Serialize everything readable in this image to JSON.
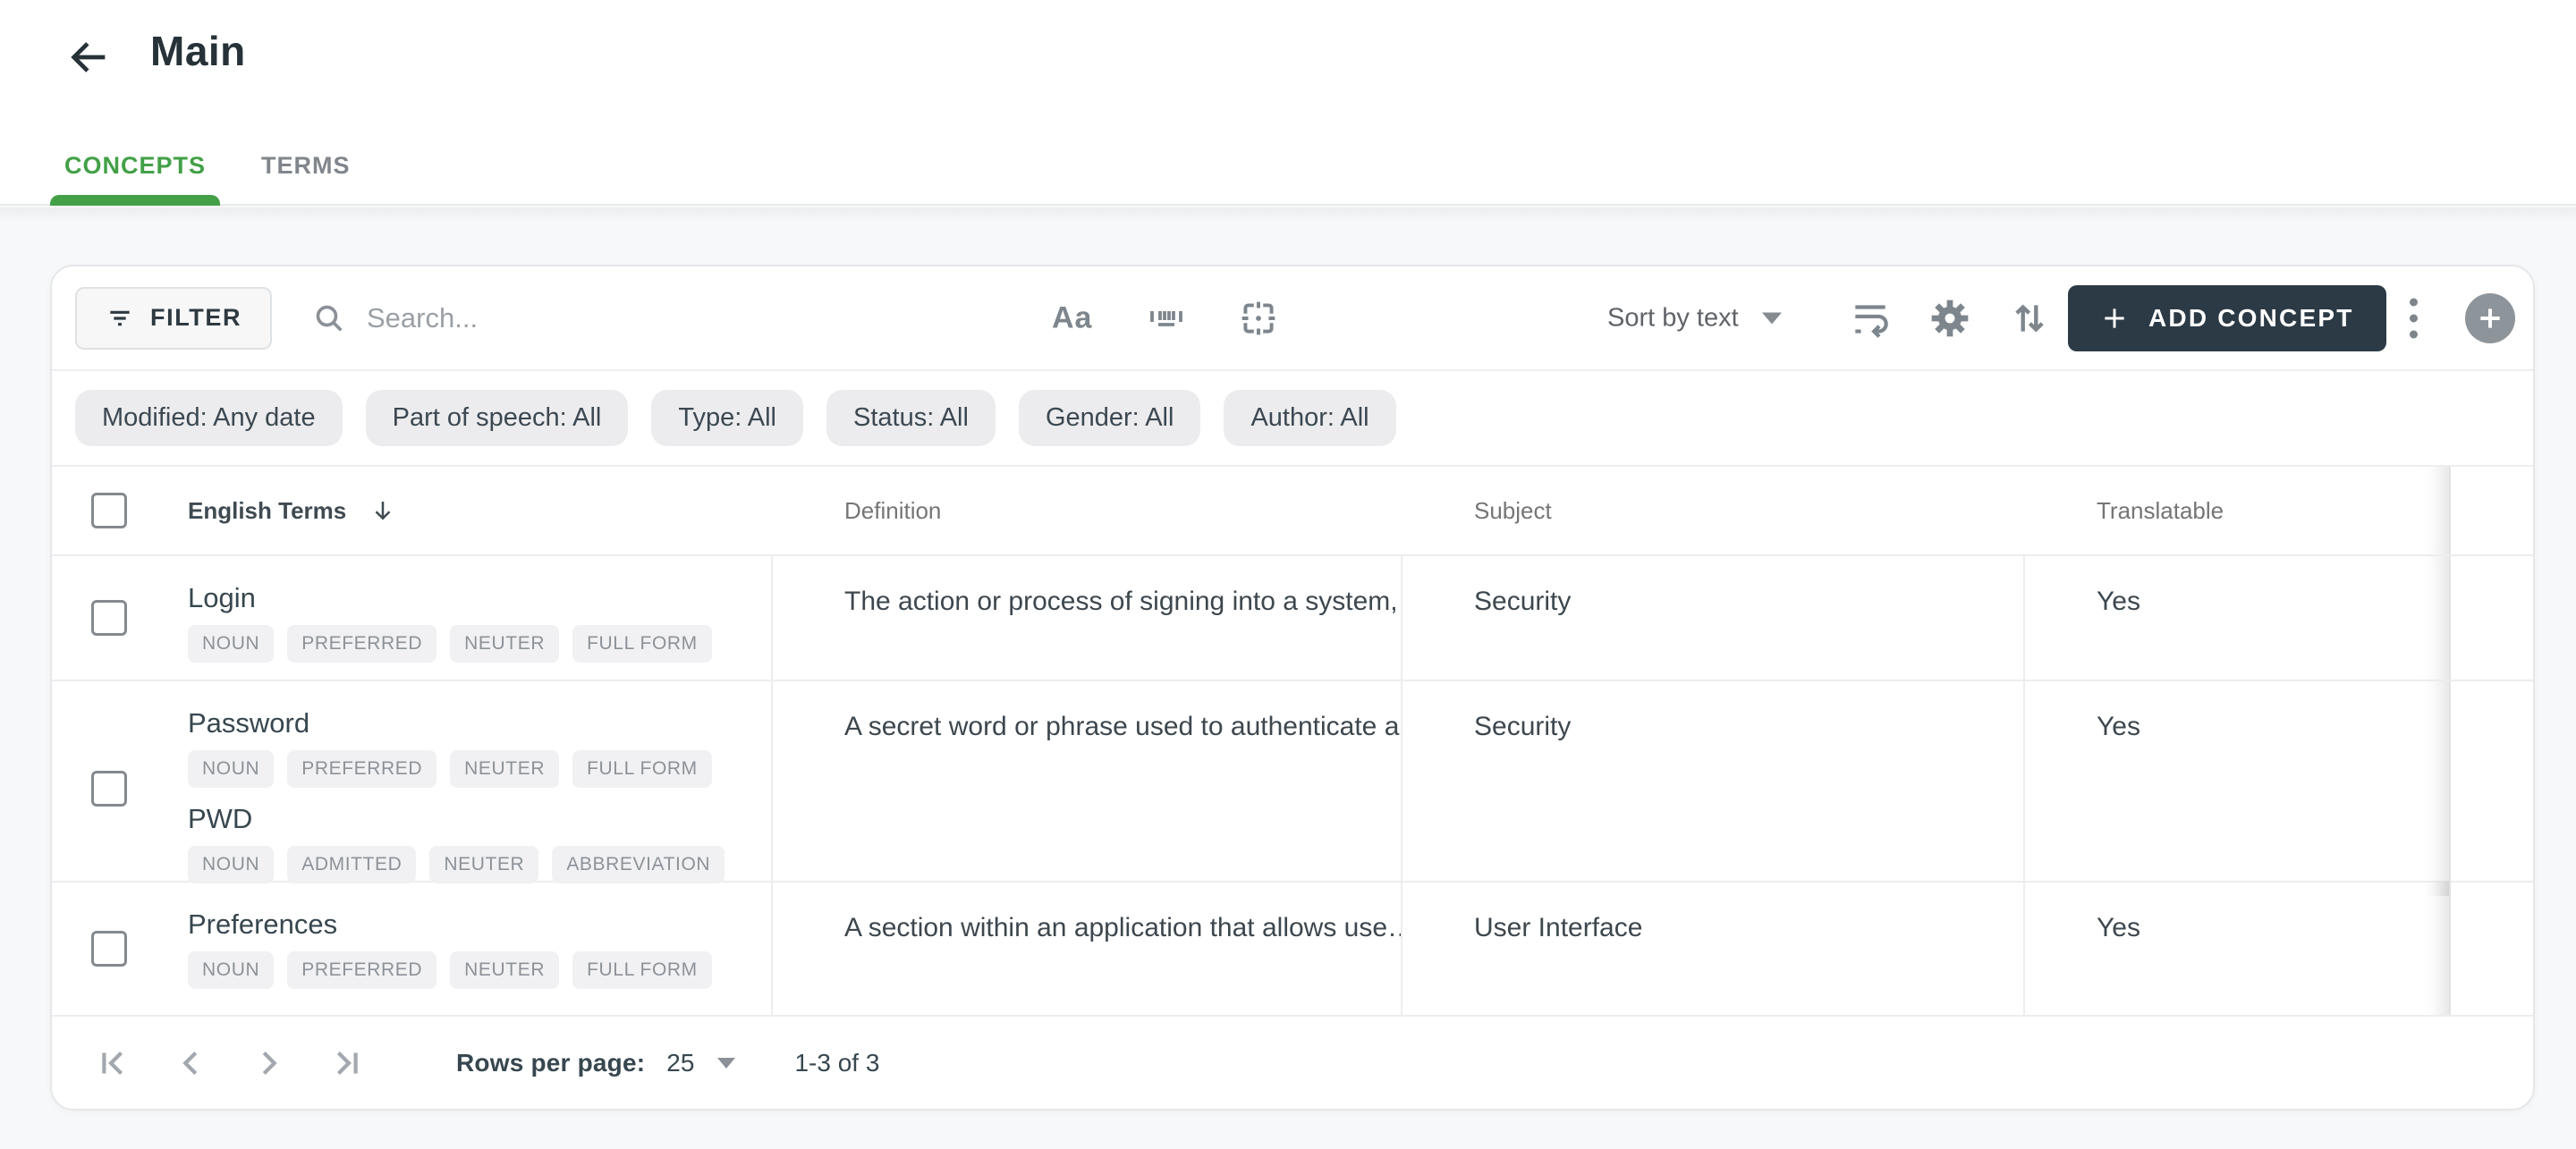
{
  "header": {
    "title": "Main"
  },
  "tabs": [
    {
      "label": "CONCEPTS",
      "active": true
    },
    {
      "label": "TERMS",
      "active": false
    }
  ],
  "toolbar": {
    "filter_label": "FILTER",
    "search_placeholder": "Search...",
    "match_case_label": "Aa",
    "sort_label": "Sort by text",
    "add_label": "ADD CONCEPT"
  },
  "icons": {
    "toolbar": [
      "filter",
      "search",
      "match-case",
      "barcode-scan",
      "focus-frame",
      "wrap-text",
      "settings-gear",
      "swap-vertical",
      "kebab-menu",
      "plus-circle"
    ],
    "pagination": [
      "first-page",
      "previous-page",
      "next-page",
      "last-page"
    ]
  },
  "filters": [
    "Modified: Any date",
    "Part of speech: All",
    "Type: All",
    "Status: All",
    "Gender: All",
    "Author: All"
  ],
  "table": {
    "columns": [
      "English Terms",
      "Definition",
      "Subject",
      "Translatable"
    ],
    "sort_column": "English Terms",
    "rows": [
      {
        "terms": [
          {
            "text": "Login",
            "tags": [
              "NOUN",
              "PREFERRED",
              "NEUTER",
              "FULL FORM"
            ]
          }
        ],
        "definition": "The action or process of signing into a system,…",
        "subject": "Security",
        "translatable": "Yes"
      },
      {
        "terms": [
          {
            "text": "Password",
            "tags": [
              "NOUN",
              "PREFERRED",
              "NEUTER",
              "FULL FORM"
            ]
          },
          {
            "text": "PWD",
            "tags": [
              "NOUN",
              "ADMITTED",
              "NEUTER",
              "ABBREVIATION"
            ]
          }
        ],
        "definition": "A secret word or phrase used to authenticate a…",
        "subject": "Security",
        "translatable": "Yes"
      },
      {
        "terms": [
          {
            "text": "Preferences",
            "tags": [
              "NOUN",
              "PREFERRED",
              "NEUTER",
              "FULL FORM"
            ]
          }
        ],
        "definition": "A section within an application that allows use…",
        "subject": "User Interface",
        "translatable": "Yes"
      }
    ]
  },
  "pagination": {
    "rows_label": "Rows per page:",
    "rows_value": "25",
    "range": "1-3 of 3"
  },
  "colors": {
    "accent_green": "#43a047",
    "dark_button": "#2c3a45",
    "chip_bg": "#ececee",
    "tag_bg": "#f1f1f3"
  }
}
